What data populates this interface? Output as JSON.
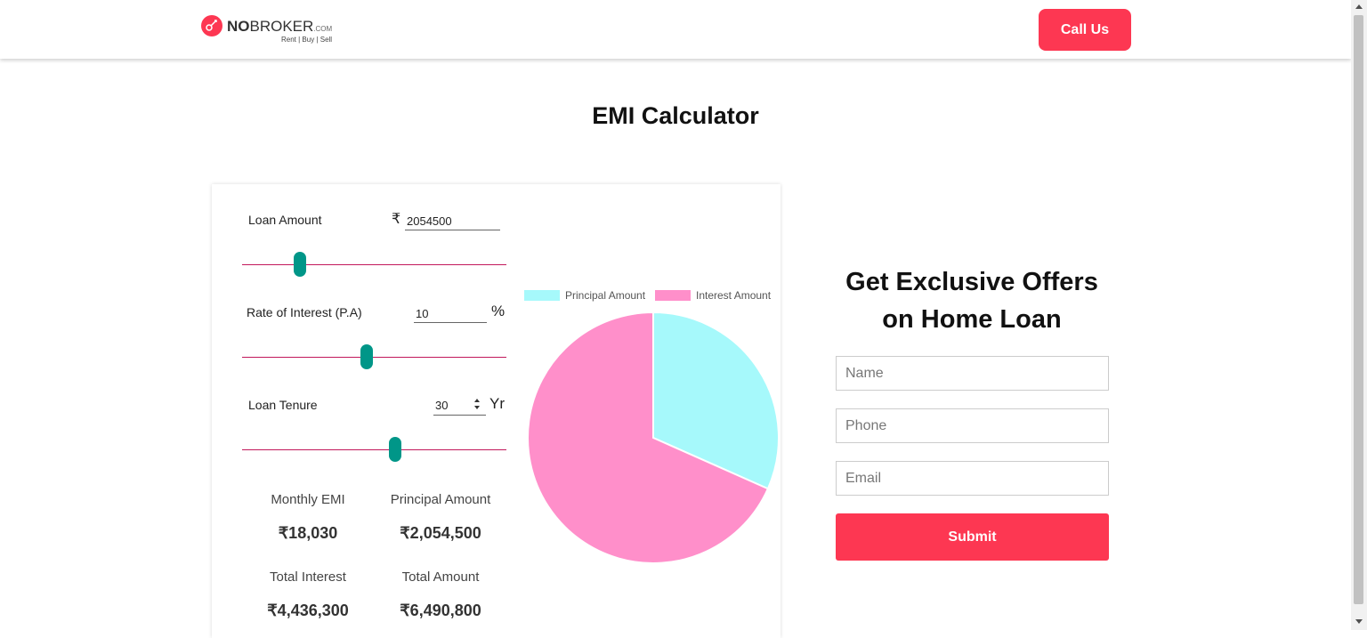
{
  "header": {
    "logo_text_bold": "NO",
    "logo_text": "BROKER",
    "logo_dotcom": ".COM",
    "logo_tagline": "Rent | Buy | Sell",
    "call_button": "Call Us"
  },
  "page_title": "EMI Calculator",
  "calculator": {
    "loan_amount": {
      "label": "Loan Amount",
      "currency": "₹",
      "value": "2054500"
    },
    "rate": {
      "label": "Rate of Interest (P.A)",
      "value": "10",
      "unit": "%"
    },
    "tenure": {
      "label": "Loan Tenure",
      "value": "30",
      "unit": "Yr"
    },
    "sliders": {
      "loan_amount_fraction": 0.22,
      "rate_fraction": 0.47,
      "tenure_fraction": 0.58
    },
    "stats": {
      "monthly_emi_label": "Monthly EMI",
      "monthly_emi_value": "₹18,030",
      "principal_label": "Principal Amount",
      "principal_value": "₹2,054,500",
      "total_interest_label": "Total Interest",
      "total_interest_value": "₹4,436,300",
      "total_amount_label": "Total Amount",
      "total_amount_value": "₹6,490,800"
    }
  },
  "chart_data": {
    "type": "pie",
    "series": [
      {
        "name": "Principal Amount",
        "value": 2054500,
        "color": "#a6f9fb"
      },
      {
        "name": "Interest Amount",
        "value": 4436300,
        "color": "#ff8fca"
      }
    ]
  },
  "offer": {
    "title_line1": "Get Exclusive Offers",
    "title_line2": "on Home Loan",
    "name_placeholder": "Name",
    "phone_placeholder": "Phone",
    "email_placeholder": "Email",
    "submit": "Submit"
  },
  "colors": {
    "brand": "#fd3752",
    "slider_thumb": "#009688",
    "slider_track": "#c2185b"
  }
}
